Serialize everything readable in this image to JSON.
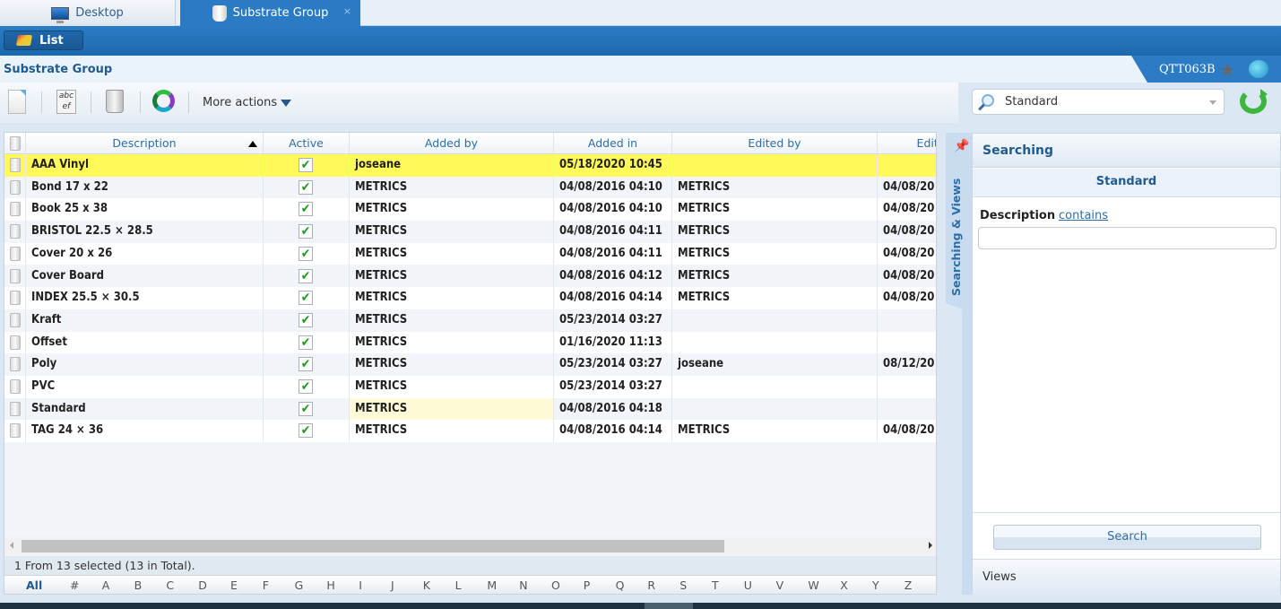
{
  "tabs": [
    {
      "label": "Desktop",
      "icon": "monitor-icon",
      "active": false
    },
    {
      "label": "Substrate Group",
      "icon": "cup-icon",
      "active": true,
      "close": "×"
    }
  ],
  "list_button": {
    "label": "List",
    "icon": "folder-icon"
  },
  "page": {
    "title": "Substrate Group",
    "user_code": "QTT063B"
  },
  "toolbar": {
    "icons": [
      "new-document-icon",
      "edit-icon",
      "recycle-bin-icon",
      "refresh-ring-icon"
    ],
    "more_actions": "More actions"
  },
  "grid": {
    "columns": [
      "",
      "Description",
      "Active",
      "Added by",
      "Added in",
      "Edited by",
      "Edite"
    ],
    "sort": {
      "column": "Description",
      "direction": "asc"
    },
    "rows": [
      {
        "description": "AAA Vinyl",
        "active": true,
        "added_by": "joseane",
        "added_in": "05/18/2020 10:45",
        "edited_by": "",
        "edited_in": "",
        "selected": true
      },
      {
        "description": "Bond 17 x 22",
        "active": true,
        "added_by": "METRICS",
        "added_in": "04/08/2016 04:10",
        "edited_by": "METRICS",
        "edited_in": "04/08/20"
      },
      {
        "description": "Book 25 x 38",
        "active": true,
        "added_by": "METRICS",
        "added_in": "04/08/2016 04:10",
        "edited_by": "METRICS",
        "edited_in": "04/08/20"
      },
      {
        "description": "BRISTOL 22.5 × 28.5",
        "active": true,
        "added_by": "METRICS",
        "added_in": "04/08/2016 04:11",
        "edited_by": "METRICS",
        "edited_in": "04/08/20"
      },
      {
        "description": "Cover 20 x 26",
        "active": true,
        "added_by": "METRICS",
        "added_in": "04/08/2016 04:11",
        "edited_by": "METRICS",
        "edited_in": "04/08/20"
      },
      {
        "description": "Cover Board",
        "active": true,
        "added_by": "METRICS",
        "added_in": "04/08/2016 04:12",
        "edited_by": "METRICS",
        "edited_in": "04/08/20"
      },
      {
        "description": "INDEX 25.5 × 30.5",
        "active": true,
        "added_by": "METRICS",
        "added_in": "04/08/2016 04:14",
        "edited_by": "METRICS",
        "edited_in": "04/08/20"
      },
      {
        "description": "Kraft",
        "active": true,
        "added_by": "METRICS",
        "added_in": "05/23/2014 03:27",
        "edited_by": "",
        "edited_in": ""
      },
      {
        "description": "Offset",
        "active": true,
        "added_by": "METRICS",
        "added_in": "01/16/2020 11:13",
        "edited_by": "",
        "edited_in": ""
      },
      {
        "description": "Poly",
        "active": true,
        "added_by": "METRICS",
        "added_in": "05/23/2014 03:27",
        "edited_by": "joseane",
        "edited_in": "08/12/20"
      },
      {
        "description": "PVC",
        "active": true,
        "added_by": "METRICS",
        "added_in": "05/23/2014 03:27",
        "edited_by": "",
        "edited_in": ""
      },
      {
        "description": "Standard",
        "active": true,
        "added_by": "METRICS",
        "added_in": "04/08/2016 04:18",
        "edited_by": "",
        "edited_in": "",
        "hover_cell": "added_by"
      },
      {
        "description": "TAG 24 × 36",
        "active": true,
        "added_by": "METRICS",
        "added_in": "04/08/2016 04:14",
        "edited_by": "METRICS",
        "edited_in": "04/08/20"
      }
    ],
    "status": "1 From 13 selected (13 in Total).",
    "alphabet": [
      "All",
      "#",
      "A",
      "B",
      "C",
      "D",
      "E",
      "F",
      "G",
      "H",
      "I",
      "J",
      "K",
      "L",
      "M",
      "N",
      "O",
      "P",
      "Q",
      "R",
      "S",
      "T",
      "U",
      "V",
      "W",
      "X",
      "Y",
      "Z"
    ],
    "alphabet_active": "All"
  },
  "side": {
    "view_select": "Standard",
    "vertical_tab": "Searching & Views",
    "panel_title": "Searching",
    "sub_title": "Standard",
    "field_label": "Description",
    "field_operator": "contains",
    "field_value": "",
    "search_button": "Search",
    "views_label": "Views"
  },
  "colors": {
    "accent": "#2b7cc4",
    "selected_row": "#fff95a",
    "hover_cell": "#fffbd6",
    "header_text": "#2d6ea8",
    "check": "#1f9a1f"
  }
}
